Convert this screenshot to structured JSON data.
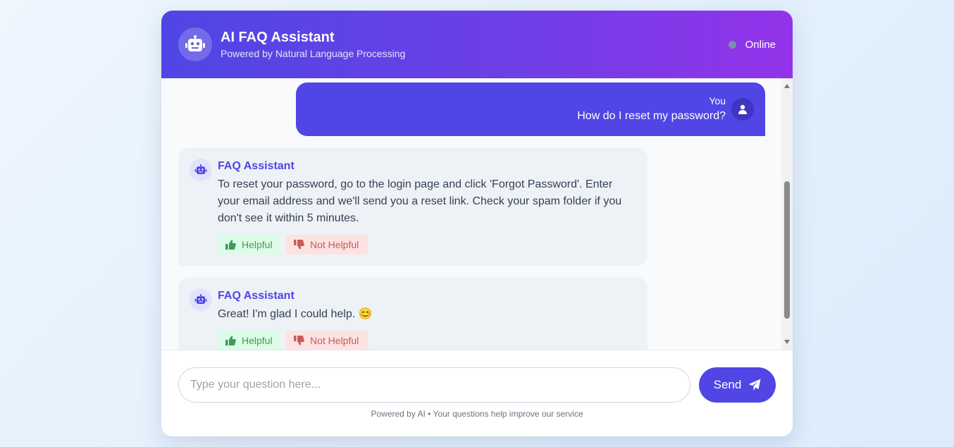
{
  "header": {
    "title": "AI FAQ Assistant",
    "subtitle": "Powered by Natural Language Processing",
    "status": "Online",
    "icon": "robot-icon"
  },
  "colors": {
    "accent": "#4f46e5",
    "header_gradient_end": "#9333ea",
    "helpful_bg": "#dcfce7",
    "not_helpful_bg": "#fde2e2"
  },
  "messages": [
    {
      "role": "user",
      "sender": "You",
      "text": "How do I reset my password?",
      "icon": "user-icon"
    },
    {
      "role": "bot",
      "sender": "FAQ Assistant",
      "text": "To reset your password, go to the login page and click 'Forgot Password'. Enter your email address and we'll send you a reset link. Check your spam folder if you don't see it within 5 minutes.",
      "helpful_label": "Helpful",
      "not_helpful_label": "Not Helpful",
      "icon": "robot-icon"
    },
    {
      "role": "bot",
      "sender": "FAQ Assistant",
      "text": "Great! I'm glad I could help. 😊",
      "helpful_label": "Helpful",
      "not_helpful_label": "Not Helpful",
      "icon": "robot-icon"
    }
  ],
  "composer": {
    "placeholder": "Type your question here...",
    "value": "",
    "send_label": "Send",
    "send_icon": "paper-plane-icon"
  },
  "footer_note": "Powered by AI • Your questions help improve our service"
}
